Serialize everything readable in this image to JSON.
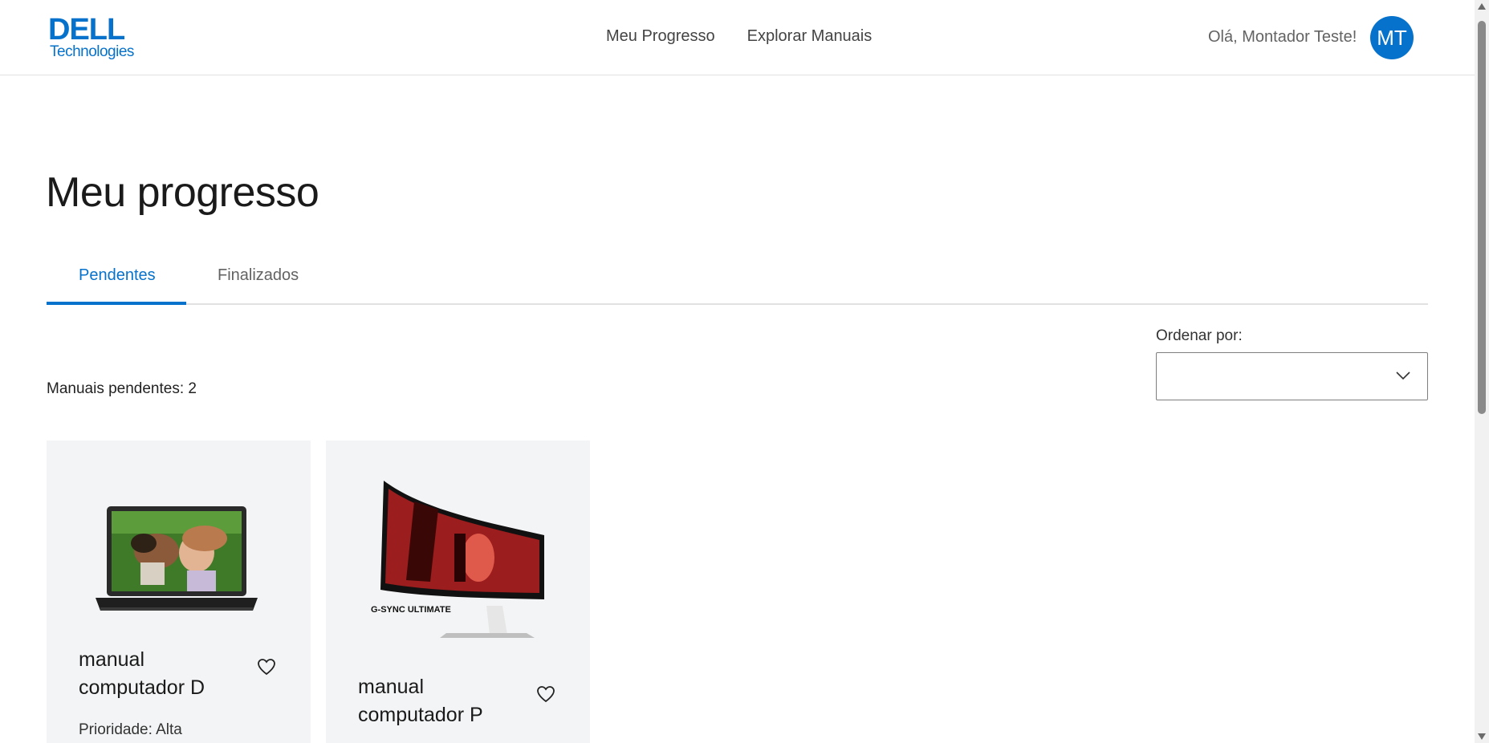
{
  "header": {
    "logo_brand": "DELL",
    "logo_sub": "Technologies",
    "nav": [
      "Meu Progresso",
      "Explorar Manuais"
    ],
    "greeting": "Olá, Montador Teste!",
    "avatar_initials": "MT"
  },
  "main": {
    "title": "Meu progresso",
    "tabs": [
      {
        "label": "Pendentes",
        "active": true
      },
      {
        "label": "Finalizados",
        "active": false
      }
    ],
    "sort": {
      "label": "Ordenar por:",
      "value": ""
    },
    "count_text": "Manuais pendentes: 2",
    "cards": [
      {
        "title": "manual computador D",
        "priority": "Prioridade: Alta",
        "image": "laptop-image"
      },
      {
        "title": "manual computador P",
        "priority": "",
        "image": "curved-monitor-image",
        "image_text": "G-SYNC ULTIMATE"
      }
    ]
  },
  "colors": {
    "accent": "#0672cb",
    "card_bg": "#f3f4f5"
  }
}
